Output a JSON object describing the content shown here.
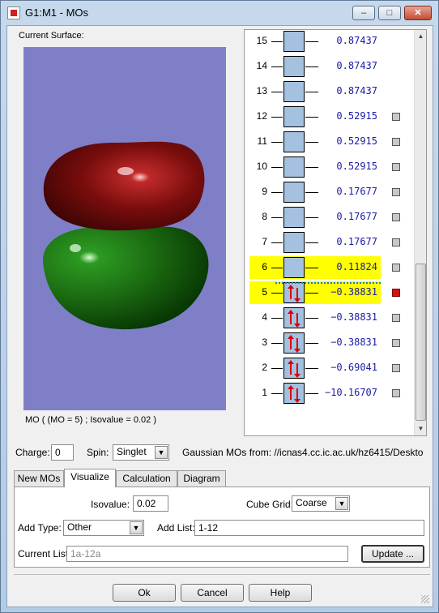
{
  "window": {
    "title": "G1:M1 - MOs",
    "minimize": "–",
    "maximize": "□",
    "close": "✕"
  },
  "surface": {
    "label": "Current Surface:",
    "caption": "MO ( (MO = 5) ; Isovalue = 0.02 )",
    "background_color": "#7f7fc8",
    "upper_lobe_color": "#7a0d0d",
    "lower_lobe_color": "#1d6e12"
  },
  "mo_list": {
    "orbitals": [
      {
        "num": "15",
        "energy": "0.87437",
        "occupied": false,
        "highlighted": false,
        "checkbox": false,
        "checked": false
      },
      {
        "num": "14",
        "energy": "0.87437",
        "occupied": false,
        "highlighted": false,
        "checkbox": false,
        "checked": false
      },
      {
        "num": "13",
        "energy": "0.87437",
        "occupied": false,
        "highlighted": false,
        "checkbox": false,
        "checked": false
      },
      {
        "num": "12",
        "energy": "0.52915",
        "occupied": false,
        "highlighted": false,
        "checkbox": true,
        "checked": false
      },
      {
        "num": "11",
        "energy": "0.52915",
        "occupied": false,
        "highlighted": false,
        "checkbox": true,
        "checked": false
      },
      {
        "num": "10",
        "energy": "0.52915",
        "occupied": false,
        "highlighted": false,
        "checkbox": true,
        "checked": false
      },
      {
        "num": "9",
        "energy": "0.17677",
        "occupied": false,
        "highlighted": false,
        "checkbox": true,
        "checked": false
      },
      {
        "num": "8",
        "energy": "0.17677",
        "occupied": false,
        "highlighted": false,
        "checkbox": true,
        "checked": false
      },
      {
        "num": "7",
        "energy": "0.17677",
        "occupied": false,
        "highlighted": false,
        "checkbox": true,
        "checked": false
      },
      {
        "num": "6",
        "energy": "0.11824",
        "occupied": false,
        "highlighted": true,
        "checkbox": true,
        "checked": false
      },
      {
        "num": "5",
        "energy": "−0.38831",
        "occupied": true,
        "highlighted": true,
        "checkbox": true,
        "checked": true
      },
      {
        "num": "4",
        "energy": "−0.38831",
        "occupied": true,
        "highlighted": false,
        "checkbox": true,
        "checked": false
      },
      {
        "num": "3",
        "energy": "−0.38831",
        "occupied": true,
        "highlighted": false,
        "checkbox": true,
        "checked": false
      },
      {
        "num": "2",
        "energy": "−0.69041",
        "occupied": true,
        "highlighted": false,
        "checkbox": true,
        "checked": false
      },
      {
        "num": "1",
        "energy": "−10.16707",
        "occupied": true,
        "highlighted": false,
        "checkbox": true,
        "checked": false
      }
    ],
    "highlight_color": "#ffff00",
    "box_color": "#a4c2df",
    "checked_color": "#d61010"
  },
  "settings": {
    "charge_label": "Charge:",
    "charge_value": "0",
    "spin_label": "Spin:",
    "spin_value": "Singlet",
    "source_text": "Gaussian MOs from:  //icnas4.cc.ic.ac.uk/hz6415/Deskto"
  },
  "tabs": [
    {
      "label": "New MOs",
      "active": false
    },
    {
      "label": "Visualize",
      "active": true
    },
    {
      "label": "Calculation",
      "active": false
    },
    {
      "label": "Diagram",
      "active": false
    }
  ],
  "visualize": {
    "isovalue_label": "Isovalue:",
    "isovalue_value": "0.02",
    "cube_grid_label": "Cube Grid:",
    "cube_grid_value": "Coarse",
    "add_type_label": "Add Type:",
    "add_type_value": "Other",
    "add_list_label": "Add List:",
    "add_list_value": "1-12",
    "current_list_label": "Current List:",
    "current_list_value": "1a-12a",
    "update_button": "Update ..."
  },
  "buttons": {
    "ok": "Ok",
    "cancel": "Cancel",
    "help": "Help"
  }
}
